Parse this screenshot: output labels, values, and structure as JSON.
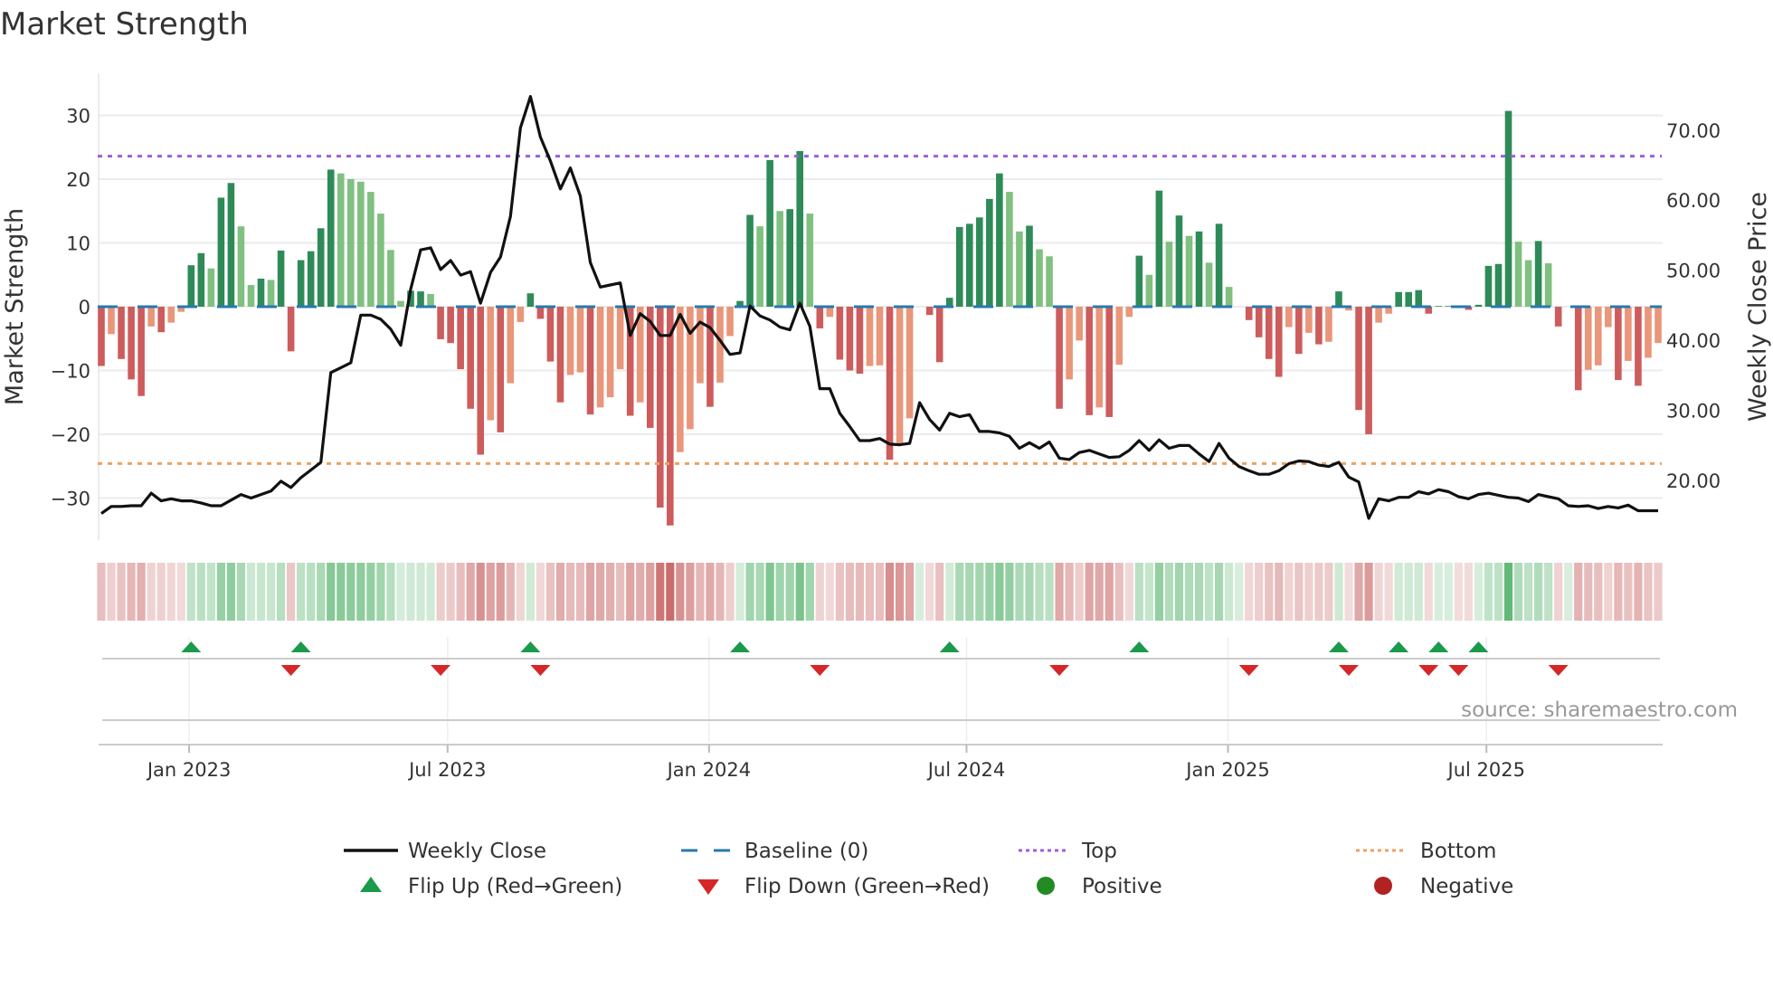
{
  "title": "Market Strength",
  "source": "source: sharemaestro.com",
  "colors": {
    "bar_pos_dark": "#2e8b57",
    "bar_pos_light": "#80c080",
    "bar_neg_dark": "#cd5c5c",
    "bar_neg_light": "#e9967a",
    "heat_pos": "#4caf64",
    "heat_neg": "#c86464",
    "close_line": "#111111",
    "baseline": "#2878b0",
    "top": "#9b5fe0",
    "bottom": "#f0a060",
    "flip_up": "#1a9a4a",
    "flip_down": "#d62728",
    "positive": "#228b22",
    "negative": "#b22222",
    "grid": "#ebebeb"
  },
  "legend": [
    {
      "label": "Weekly Close",
      "symbol": "line"
    },
    {
      "label": "Baseline (0)",
      "symbol": "dash"
    },
    {
      "label": "Top",
      "symbol": "dot-purple"
    },
    {
      "label": "Bottom",
      "symbol": "dot-orange"
    },
    {
      "label": "Flip Up (Red→Green)",
      "symbol": "triangle-up"
    },
    {
      "label": "Flip Down (Green→Red)",
      "symbol": "triangle-down"
    },
    {
      "label": "Positive",
      "symbol": "circle-green"
    },
    {
      "label": "Negative",
      "symbol": "circle-red"
    }
  ],
  "chart_data": {
    "type": "bar",
    "title": "Market Strength",
    "ylabel": "Market Strength",
    "y2label": "Weekly Close Price",
    "ylim": [
      -36.6,
      36.6
    ],
    "y2lim": [
      11.5,
      78.1
    ],
    "yticks": [
      {
        "value": 30,
        "label": "30"
      },
      {
        "value": 20,
        "label": "20"
      },
      {
        "value": 10,
        "label": "10"
      },
      {
        "value": 0,
        "label": "0"
      },
      {
        "value": -10,
        "label": "−10"
      },
      {
        "value": -20,
        "label": "−20"
      },
      {
        "value": -30,
        "label": "−30"
      }
    ],
    "y2ticks": [
      {
        "value": 70,
        "label": "70.00"
      },
      {
        "value": 60,
        "label": "60.00"
      },
      {
        "value": 50,
        "label": "50.00"
      },
      {
        "value": 40,
        "label": "40.00"
      },
      {
        "value": 30,
        "label": "30.00"
      },
      {
        "value": 20,
        "label": "20.00"
      }
    ],
    "xticks": [
      {
        "label": "Jan 2023",
        "week": 9.8
      },
      {
        "label": "Jul 2023",
        "week": 35.7
      },
      {
        "label": "Jan 2024",
        "week": 61.9
      },
      {
        "label": "Jul 2024",
        "week": 87.7
      },
      {
        "label": "Jan 2025",
        "week": 113.9
      },
      {
        "label": "Jul 2025",
        "week": 139.8
      }
    ],
    "baseline": 0,
    "top": 23.6,
    "bottom": -24.6,
    "strength": [
      -9.3,
      -4.3,
      -8.2,
      -11.4,
      -14.0,
      -3.1,
      -4.0,
      -2.5,
      -0.8,
      6.5,
      8.4,
      6.0,
      17.1,
      19.4,
      12.6,
      3.4,
      4.4,
      4.2,
      8.8,
      -7.0,
      7.3,
      8.7,
      12.3,
      21.5,
      20.9,
      20.0,
      19.6,
      18.0,
      14.6,
      8.9,
      0.9,
      2.5,
      2.4,
      2.0,
      -5.1,
      -5.7,
      -9.8,
      -16.0,
      -23.2,
      -17.8,
      -19.7,
      -12.0,
      -2.4,
      2.1,
      -1.9,
      -8.6,
      -15.0,
      -10.7,
      -10.3,
      -16.9,
      -15.8,
      -14.2,
      -9.8,
      -17.1,
      -15.0,
      -19.0,
      -31.5,
      -34.3,
      -22.8,
      -19.2,
      -12.0,
      -15.7,
      -11.9,
      -4.6,
      0.9,
      14.4,
      12.6,
      23.0,
      15.0,
      15.3,
      24.4,
      14.6,
      -3.4,
      -1.6,
      -8.3,
      -10.0,
      -10.5,
      -9.3,
      -9.2,
      -24.0,
      -21.4,
      -17.5,
      0,
      -1.3,
      -8.7,
      1.4,
      12.5,
      13.0,
      14.0,
      16.9,
      20.9,
      18.0,
      11.8,
      12.7,
      9.0,
      7.9,
      -16.0,
      -11.4,
      -5.3,
      -17.0,
      -15.8,
      -17.3,
      -9.1,
      -1.6,
      8.0,
      5.0,
      18.2,
      10.2,
      14.3,
      11.1,
      11.8,
      6.9,
      13.0,
      3.1,
      0,
      -2.1,
      -4.8,
      -8.2,
      -11.0,
      -3.2,
      -7.4,
      -4.1,
      -5.9,
      -5.5,
      2.4,
      -0.6,
      -16.2,
      -20.0,
      -2.5,
      -1.1,
      2.3,
      2.3,
      2.6,
      -1.1,
      0.1,
      0.1,
      -0.2,
      -0.5,
      0.3,
      6.4,
      6.7,
      30.7,
      10.2,
      7.3,
      10.3,
      6.8,
      -3.1,
      0,
      -13.1,
      -9.9,
      -9.2,
      -3.2,
      -11.5,
      -8.5,
      -12.4,
      -8.0,
      -5.7
    ],
    "shade_dark": [
      1,
      0,
      1,
      1,
      1,
      0,
      1,
      0,
      0,
      1,
      1,
      0,
      1,
      1,
      0,
      0,
      1,
      0,
      1,
      1,
      1,
      1,
      1,
      1,
      0,
      0,
      0,
      0,
      0,
      0,
      0,
      1,
      1,
      0,
      1,
      1,
      1,
      1,
      1,
      0,
      1,
      0,
      0,
      1,
      1,
      1,
      1,
      0,
      0,
      1,
      0,
      0,
      0,
      1,
      0,
      1,
      1,
      1,
      0,
      0,
      0,
      1,
      0,
      0,
      1,
      1,
      0,
      1,
      0,
      1,
      1,
      0,
      1,
      0,
      1,
      1,
      1,
      0,
      0,
      1,
      0,
      0,
      0,
      1,
      1,
      1,
      1,
      1,
      1,
      1,
      1,
      0,
      0,
      1,
      0,
      0,
      1,
      0,
      0,
      1,
      0,
      1,
      0,
      0,
      1,
      0,
      1,
      0,
      1,
      0,
      1,
      0,
      1,
      0,
      0,
      1,
      1,
      1,
      1,
      0,
      1,
      0,
      1,
      0,
      1,
      0,
      1,
      1,
      0,
      0,
      1,
      1,
      1,
      1,
      1,
      1,
      0,
      1,
      1,
      1,
      1,
      1,
      0,
      0,
      1,
      0,
      1,
      0,
      1,
      0,
      0,
      0,
      1,
      0,
      1,
      0,
      0
    ],
    "close": [
      15.3,
      16.3,
      16.3,
      16.4,
      16.4,
      18.2,
      17.1,
      17.4,
      17.1,
      17.1,
      16.8,
      16.4,
      16.4,
      17.2,
      18.0,
      17.5,
      18.0,
      18.5,
      19.9,
      19.0,
      20.4,
      21.5,
      22.6,
      35.4,
      36.1,
      36.8,
      43.6,
      43.6,
      43.0,
      41.6,
      39.3,
      47.3,
      52.9,
      53.2,
      50.1,
      51.4,
      49.3,
      49.8,
      45.3,
      49.7,
      51.9,
      57.7,
      70.3,
      74.8,
      69.0,
      65.6,
      61.6,
      64.6,
      60.6,
      51.1,
      47.6,
      47.9,
      48.2,
      40.7,
      43.8,
      42.7,
      40.7,
      40.7,
      43.7,
      41.0,
      42.6,
      41.8,
      40.0,
      38.0,
      38.2,
      44.9,
      43.5,
      42.9,
      41.9,
      41.5,
      45.3,
      42.0,
      33.1,
      33.1,
      29.6,
      27.7,
      25.7,
      25.7,
      26.0,
      25.2,
      25.1,
      25.3,
      31.1,
      28.7,
      27.2,
      29.6,
      29.1,
      29.4,
      27.0,
      27.0,
      26.8,
      26.3,
      24.6,
      25.4,
      24.6,
      25.5,
      23.2,
      23.0,
      24.0,
      24.3,
      23.8,
      23.3,
      23.4,
      24.3,
      25.7,
      24.3,
      25.8,
      24.6,
      25.0,
      25.0,
      23.8,
      22.7,
      25.3,
      23.2,
      22.0,
      21.4,
      20.9,
      20.9,
      21.4,
      22.4,
      22.8,
      22.7,
      22.2,
      22.0,
      22.6,
      20.5,
      19.8,
      14.6,
      17.4,
      17.1,
      17.6,
      17.6,
      18.4,
      18.1,
      18.7,
      18.4,
      17.7,
      17.4,
      18.0,
      18.2,
      17.9,
      17.6,
      17.5,
      17.0,
      18.0,
      17.7,
      17.4,
      16.4,
      16.3,
      16.4,
      16.0,
      16.3,
      16.1,
      16.5,
      15.7,
      15.7,
      15.7
    ],
    "flip_up_weeks": [
      10,
      21,
      44,
      65,
      86,
      105,
      125,
      131,
      135,
      139
    ],
    "flip_down_weeks": [
      20,
      35,
      45,
      73,
      97,
      116,
      126,
      134,
      137,
      147
    ]
  }
}
